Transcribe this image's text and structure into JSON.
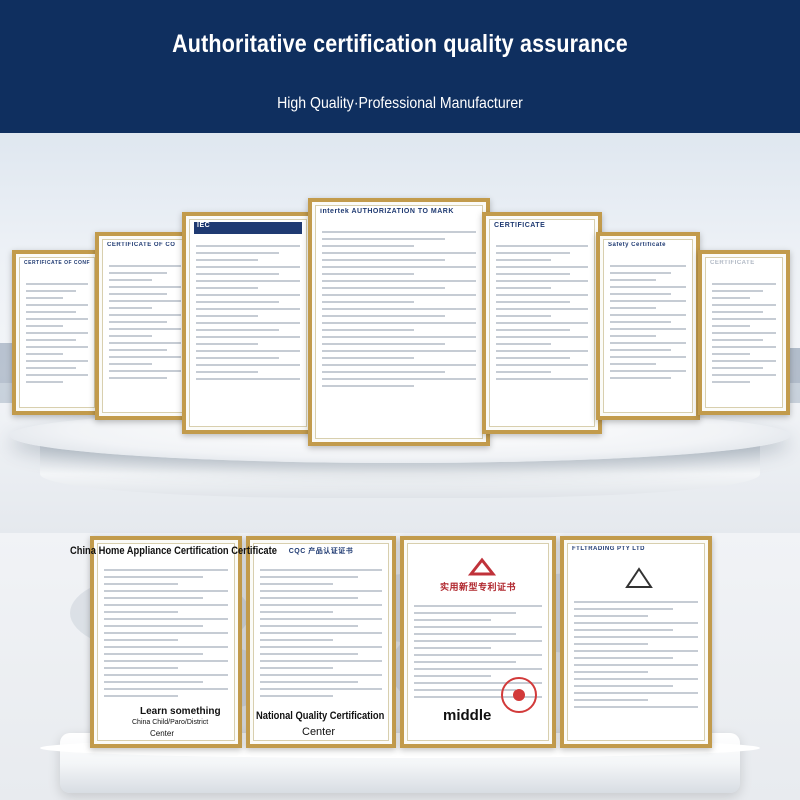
{
  "header": {
    "title": "Authoritative certification quality assurance",
    "subtitle": "High Quality·Professional Manufacturer"
  },
  "top_certificates": [
    {
      "head": "CERTIFICATE OF CONF"
    },
    {
      "head": "CERTIFICATE OF CO"
    },
    {
      "head": "IEC"
    },
    {
      "head": "intertek    AUTHORIZATION TO MARK"
    },
    {
      "head": "CERTIFICATE"
    },
    {
      "head": "Safety Certificate"
    },
    {
      "head": "CERTIFICATE"
    }
  ],
  "bottom_labels": {
    "china_home": "China Home Appliance Certification Certificate",
    "learn": "Learn something",
    "china_child": "China Child/Paro/District",
    "center_small": "Center",
    "national": "National Quality Certification",
    "center": "Center",
    "middle": "middle"
  },
  "bottom_certificates": [
    {
      "head": ""
    },
    {
      "head": "CQC 产品认证证书"
    },
    {
      "head": "实用新型专利证书"
    },
    {
      "head": "FTLTRADING PTY LTD"
    }
  ],
  "colors": {
    "header_bg": "#0f2f5f",
    "frame_gold": "#c29b4c"
  }
}
